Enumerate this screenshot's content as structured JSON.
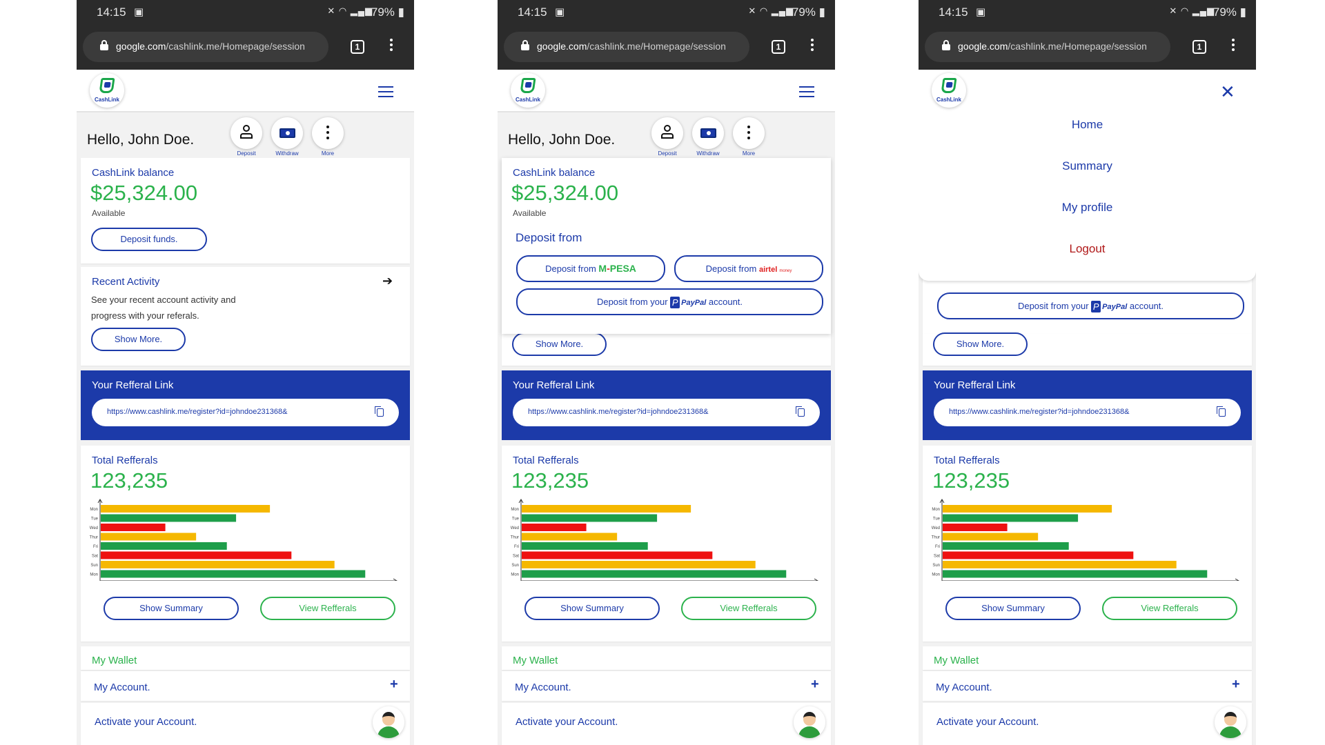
{
  "status_bar": {
    "time": "14:15",
    "battery": "79%"
  },
  "browser": {
    "url_domain": "google.com",
    "url_path": "/cashlink.me/Homepage/session",
    "tab_count": "1"
  },
  "app": {
    "logo_text": "CashLink",
    "greeting": "Hello, John Doe.",
    "actions": {
      "deposit": "Deposit",
      "withdraw": "Withdraw",
      "more": "More"
    },
    "balance": {
      "label": "CashLink balance",
      "amount": "$25,324.00",
      "available": "Available",
      "deposit_button": "Deposit funds."
    },
    "recent_activity": {
      "title": "Recent Activity",
      "description": "See your recent account activity and progress with your referals.",
      "show_more": "Show More."
    },
    "deposit_from": {
      "title": "Deposit from",
      "mpesa_prefix": "Deposit from",
      "mpesa_logo_m": "M",
      "mpesa_logo_rest": "PESA",
      "airtel_prefix": "Deposit from",
      "airtel_logo": "airtel",
      "airtel_sub": "money",
      "paypal_prefix": "Deposit from your",
      "paypal_logo": "PayPal",
      "paypal_suffix": "account."
    },
    "referral_link": {
      "title": "Your Refferal Link",
      "url": "https://www.cashlink.me/register?id=johndoe231368&"
    },
    "total_referrals": {
      "label": "Total Refferals",
      "value": "123,235",
      "show_summary": "Show Summary",
      "view_referrals": "View Refferals"
    },
    "wallet": {
      "title": "My Wallet",
      "account": "My Account.",
      "activate": "Activate your Account."
    },
    "nav_menu": {
      "home": "Home",
      "summary": "Summary",
      "profile": "My profile",
      "logout": "Logout"
    }
  },
  "chart_data": {
    "type": "bar",
    "orientation": "horizontal",
    "categories": [
      "Mon",
      "Tue",
      "Wed",
      "Thur",
      "Fri",
      "Sat",
      "Sun",
      "Mon"
    ],
    "values": [
      55,
      44,
      21,
      31,
      41,
      62,
      76,
      86
    ],
    "xlim": [
      0,
      92
    ],
    "colors": [
      "#f5b800",
      "#1e9e4a",
      "#ee1111",
      "#f5b800",
      "#1e9e4a",
      "#ee1111",
      "#f5b800",
      "#1e9e4a"
    ]
  },
  "colors": {
    "brand_blue": "#1c3aa9",
    "brand_green": "#2bb24c",
    "logout_red": "#b01818"
  }
}
